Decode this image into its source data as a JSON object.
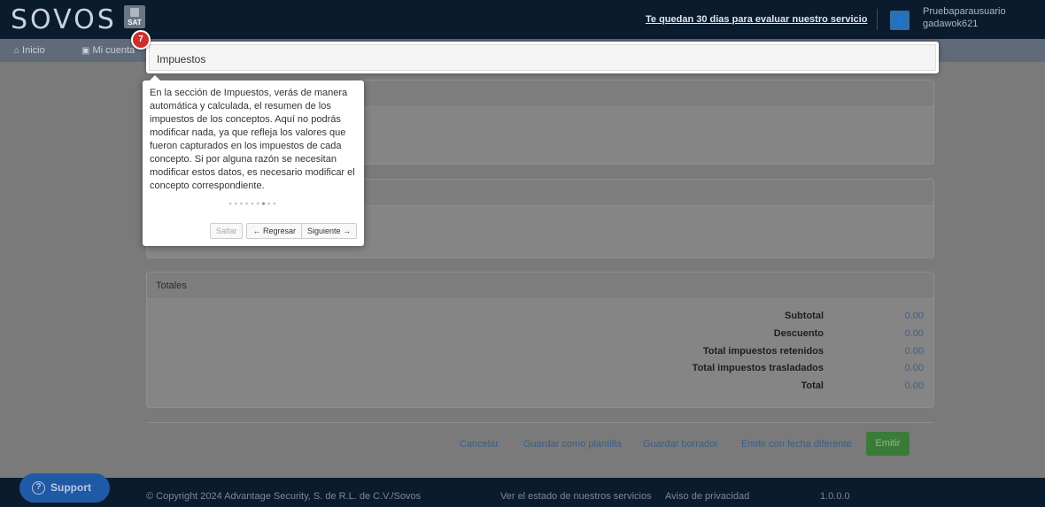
{
  "header": {
    "logo": "SOVOS",
    "sat_label": "SAT",
    "trial_notice": "Te quedan 30 dias para evaluar nuestro servicio",
    "user_line1": "Pruebaparausuario",
    "user_line2": "gadawok621"
  },
  "nav": {
    "home": "Inicio",
    "account": "Mi cuenta"
  },
  "tour": {
    "step": "7",
    "highlight_title": "Impuestos",
    "text": "En la sección de Impuestos, verás de manera automática y calculada, el resumen de los impuestos de los conceptos. Aquí no podrás modificar nada, ya que refleja los valores que fueron capturados en los impuestos de cada concepto. Si por alguna razón se necesitan modificar estos datos, es necesario modificar el concepto correspondiente.",
    "skip": "Saltar",
    "back": "← Regresar",
    "next": "Siguiente →",
    "dots_total": 9,
    "dots_active": 7
  },
  "totals": {
    "title": "Totales",
    "rows": [
      {
        "label": "Subtotal",
        "value": "0.00"
      },
      {
        "label": "Descuento",
        "value": "0.00"
      },
      {
        "label": "Total impuestos retenidos",
        "value": "0.00"
      },
      {
        "label": "Total impuestos trasladados",
        "value": "0.00"
      },
      {
        "label": "Total",
        "value": "0.00"
      }
    ]
  },
  "actions": {
    "cancel": "Cancelar",
    "save_template": "Guardar como plantilla",
    "save_draft": "Guardar borrador",
    "emit_different_date": "Emitir con fecha diferente",
    "emit": "Emitir"
  },
  "footer": {
    "support": "Support",
    "copyright": "© Copyright 2024 Advantage Security, S. de R.L. de C.V./Sovos",
    "status": "Ver el estado de nuestros servicios",
    "privacy": "Aviso de privacidad",
    "version": "1.0.0.0"
  }
}
